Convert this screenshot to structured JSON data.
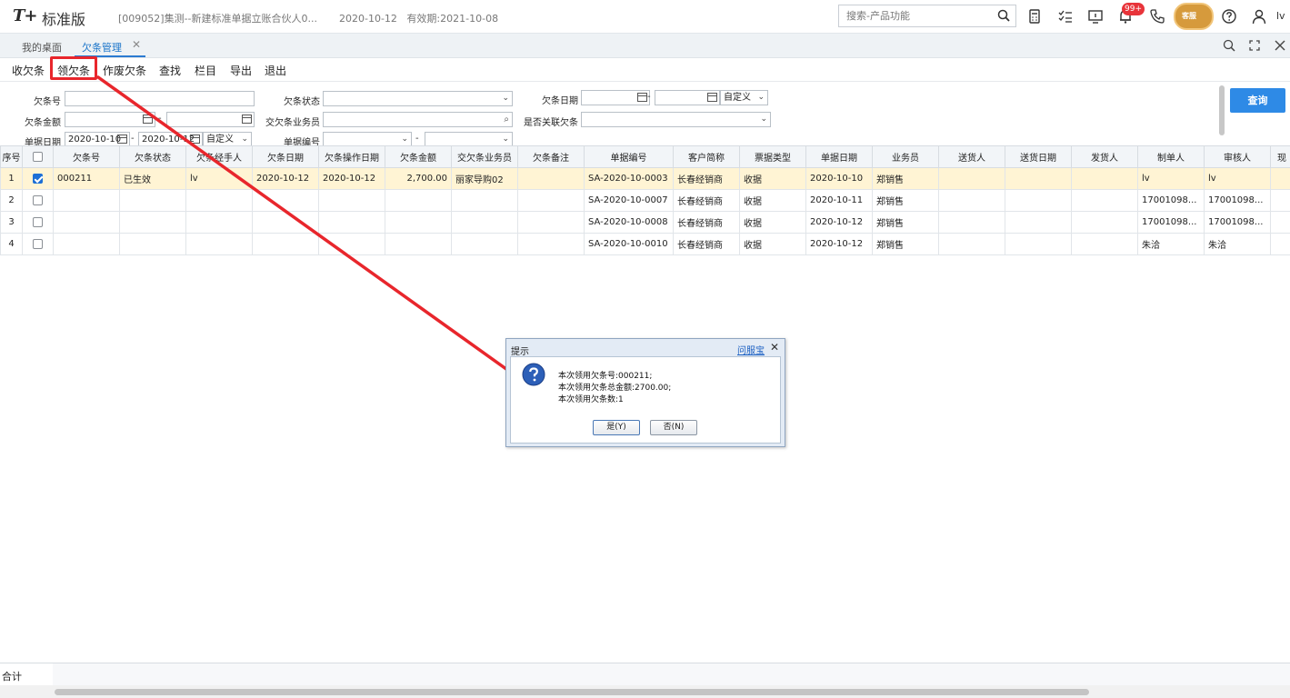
{
  "header": {
    "logo_text": "T+",
    "edition": "标准版",
    "company": "[009052]集测--新建标准单据立账合伙人0...",
    "date": "2020-10-12",
    "validity": "有效期:2021-10-08",
    "search_placeholder": "搜索-产品功能",
    "notification_badge": "99+",
    "mascot_label": "客服",
    "user": "lv"
  },
  "tabs": [
    {
      "label": "我的桌面"
    },
    {
      "label": "欠条管理"
    }
  ],
  "menu": [
    "收欠条",
    "领欠条",
    "作废欠条",
    "查找",
    "栏目",
    "导出",
    "退出"
  ],
  "filters": {
    "iou_no_label": "欠条号",
    "iou_status_label": "欠条状态",
    "iou_date_label": "欠条日期",
    "iou_date_mode": "自定义",
    "iou_amount_label": "欠条金额",
    "salesman_label": "交欠条业务员",
    "linked_label": "是否关联欠条",
    "doc_date_label": "单据日期",
    "doc_date_from": "2020-10-10",
    "doc_date_to": "2020-10-12",
    "doc_date_mode": "自定义",
    "doc_no_label": "单据编号",
    "query_button": "查询"
  },
  "table": {
    "columns": [
      "序号",
      "欠条号",
      "欠条状态",
      "欠条经手人",
      "欠条日期",
      "欠条操作日期",
      "欠条金额",
      "交欠条业务员",
      "欠条备注",
      "单据编号",
      "客户简称",
      "票据类型",
      "单据日期",
      "业务员",
      "送货人",
      "送货日期",
      "发货人",
      "制单人",
      "审核人",
      "现"
    ],
    "rows": [
      {
        "seq": "1",
        "checked": true,
        "iou_no": "000211",
        "status": "已生效",
        "handler": "lv",
        "iou_date": "2020-10-12",
        "op_date": "2020-10-12",
        "amount": "2,700.00",
        "salesman": "丽家导购02",
        "remark": "",
        "doc_no": "SA-2020-10-0003",
        "customer": "长春经销商",
        "bill_type": "收据",
        "doc_date": "2020-10-10",
        "clerk": "郑销售",
        "deliverer": "",
        "delivery_date": "",
        "shipper": "",
        "maker": "lv",
        "auditor": "lv"
      },
      {
        "seq": "2",
        "checked": false,
        "iou_no": "",
        "status": "",
        "handler": "",
        "iou_date": "",
        "op_date": "",
        "amount": "",
        "salesman": "",
        "remark": "",
        "doc_no": "SA-2020-10-0007",
        "customer": "长春经销商",
        "bill_type": "收据",
        "doc_date": "2020-10-11",
        "clerk": "郑销售",
        "deliverer": "",
        "delivery_date": "",
        "shipper": "",
        "maker": "17001098...",
        "auditor": "17001098..."
      },
      {
        "seq": "3",
        "checked": false,
        "iou_no": "",
        "status": "",
        "handler": "",
        "iou_date": "",
        "op_date": "",
        "amount": "",
        "salesman": "",
        "remark": "",
        "doc_no": "SA-2020-10-0008",
        "customer": "长春经销商",
        "bill_type": "收据",
        "doc_date": "2020-10-12",
        "clerk": "郑销售",
        "deliverer": "",
        "delivery_date": "",
        "shipper": "",
        "maker": "17001098...",
        "auditor": "17001098..."
      },
      {
        "seq": "4",
        "checked": false,
        "iou_no": "",
        "status": "",
        "handler": "",
        "iou_date": "",
        "op_date": "",
        "amount": "",
        "salesman": "",
        "remark": "",
        "doc_no": "SA-2020-10-0010",
        "customer": "长春经销商",
        "bill_type": "收据",
        "doc_date": "2020-10-12",
        "clerk": "郑销售",
        "deliverer": "",
        "delivery_date": "",
        "shipper": "",
        "maker": "朱洽",
        "auditor": "朱洽"
      }
    ]
  },
  "footer": {
    "total_label": "合计"
  },
  "dialog": {
    "title": "提示",
    "help_link": "问服宝",
    "lines": [
      "本次领用欠条号:000211;",
      "本次领用欠条总金额:2700.00;",
      "本次领用欠条数:1"
    ],
    "yes_label": "是(Y)",
    "no_label": "否(N)"
  },
  "colors": {
    "accent": "#2e8ae6",
    "selected_row": "#fff4d4",
    "annotation": "#e8262c"
  }
}
